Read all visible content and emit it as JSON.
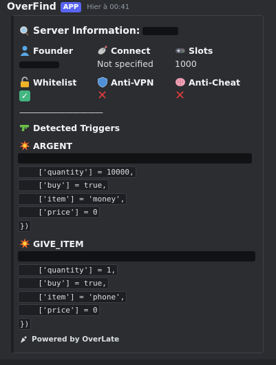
{
  "message": {
    "author": "OverFind",
    "badge": "APP",
    "timestamp": "Hier à 00:41"
  },
  "embed": {
    "title": "Server Information:",
    "fields": {
      "founder": {
        "name": "Founder",
        "value": ""
      },
      "connect": {
        "name": "Connect",
        "value": "Not specified"
      },
      "slots": {
        "name": "Slots",
        "value": "1000"
      },
      "whitelist": {
        "name": "Whitelist",
        "value_icon": "check-icon"
      },
      "anticheat_vpn": {
        "name": "Anti-VPN",
        "value_icon": "cross-icon"
      },
      "anticheat": {
        "name": "Anti-Cheat",
        "value_icon": "cross-icon"
      }
    },
    "divider": "———————————",
    "detected_title": "Detected Triggers",
    "triggers": [
      {
        "name": "ARGENT",
        "lines": [
          "",
          "    ['quantity'] = 10000,",
          "    ['buy'] = true,",
          "    ['item'] = 'money',",
          "    ['price'] = 0",
          "})"
        ]
      },
      {
        "name": "GIVE_ITEM",
        "lines": [
          "",
          "    ['quantity'] = 1,",
          "    ['buy'] = true,",
          "    ['item'] = 'phone',",
          "    ['price'] = 0",
          "})"
        ]
      }
    ],
    "footer": "Powered by OverLate"
  },
  "colors": {
    "background": "#2b2d31",
    "badge": "#5865f2",
    "code_bg": "#1e1f22",
    "check": "#43b581",
    "cross": "#e03c3c"
  }
}
